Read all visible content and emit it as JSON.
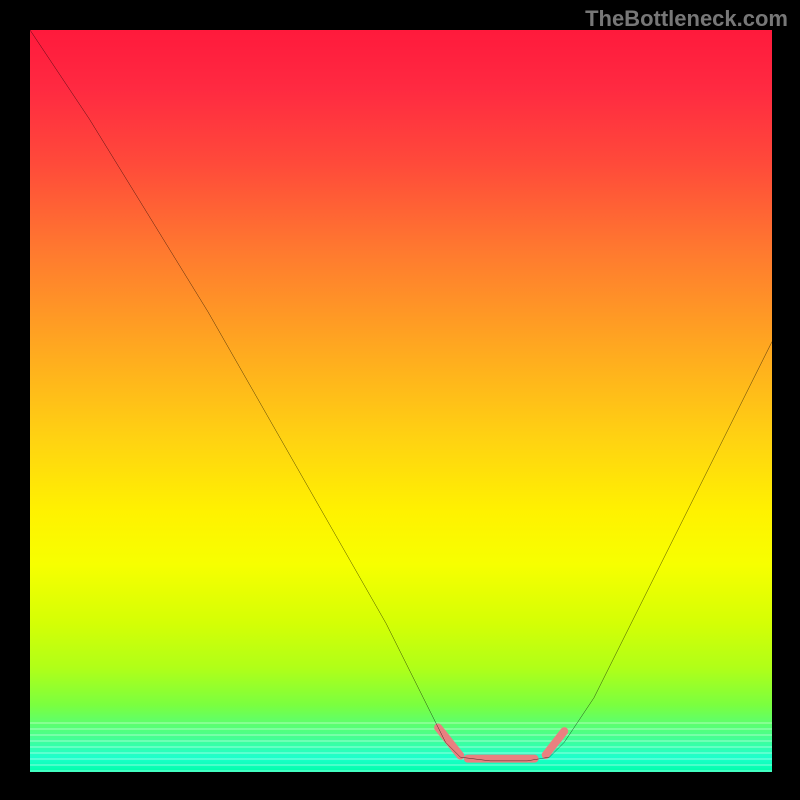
{
  "watermark": "TheBottleneck.com",
  "chart_data": {
    "type": "line",
    "title": "",
    "xlabel": "",
    "ylabel": "",
    "xlim": [
      0,
      100
    ],
    "ylim": [
      0,
      100
    ],
    "grid": false,
    "legend": false,
    "gradient": {
      "stops": [
        {
          "pos": 0,
          "color": "#ff1a3c"
        },
        {
          "pos": 30,
          "color": "#ff7a2f"
        },
        {
          "pos": 55,
          "color": "#ffd212"
        },
        {
          "pos": 72,
          "color": "#f7ff00"
        },
        {
          "pos": 91,
          "color": "#7aff40"
        },
        {
          "pos": 100,
          "color": "#00ffaa"
        }
      ]
    },
    "series": [
      {
        "name": "curve",
        "color": "#000000",
        "width": 2,
        "points": [
          {
            "x": 0,
            "y": 100
          },
          {
            "x": 8,
            "y": 88
          },
          {
            "x": 16,
            "y": 75
          },
          {
            "x": 24,
            "y": 62
          },
          {
            "x": 32,
            "y": 48
          },
          {
            "x": 40,
            "y": 34
          },
          {
            "x": 48,
            "y": 20
          },
          {
            "x": 53,
            "y": 10
          },
          {
            "x": 56,
            "y": 4
          },
          {
            "x": 58,
            "y": 2
          },
          {
            "x": 62,
            "y": 1.5
          },
          {
            "x": 67,
            "y": 1.5
          },
          {
            "x": 70,
            "y": 2
          },
          {
            "x": 72,
            "y": 4
          },
          {
            "x": 76,
            "y": 10
          },
          {
            "x": 82,
            "y": 22
          },
          {
            "x": 88,
            "y": 34
          },
          {
            "x": 94,
            "y": 46
          },
          {
            "x": 100,
            "y": 58
          }
        ]
      }
    ],
    "highlight": {
      "color": "#e98080",
      "width": 8,
      "segments": [
        {
          "from": {
            "x": 55,
            "y": 6
          },
          "to": {
            "x": 58,
            "y": 2.2
          }
        },
        {
          "from": {
            "x": 59,
            "y": 1.8
          },
          "to": {
            "x": 68,
            "y": 1.8
          }
        },
        {
          "from": {
            "x": 69.5,
            "y": 2.3
          },
          "to": {
            "x": 72,
            "y": 5.5
          }
        }
      ]
    }
  }
}
